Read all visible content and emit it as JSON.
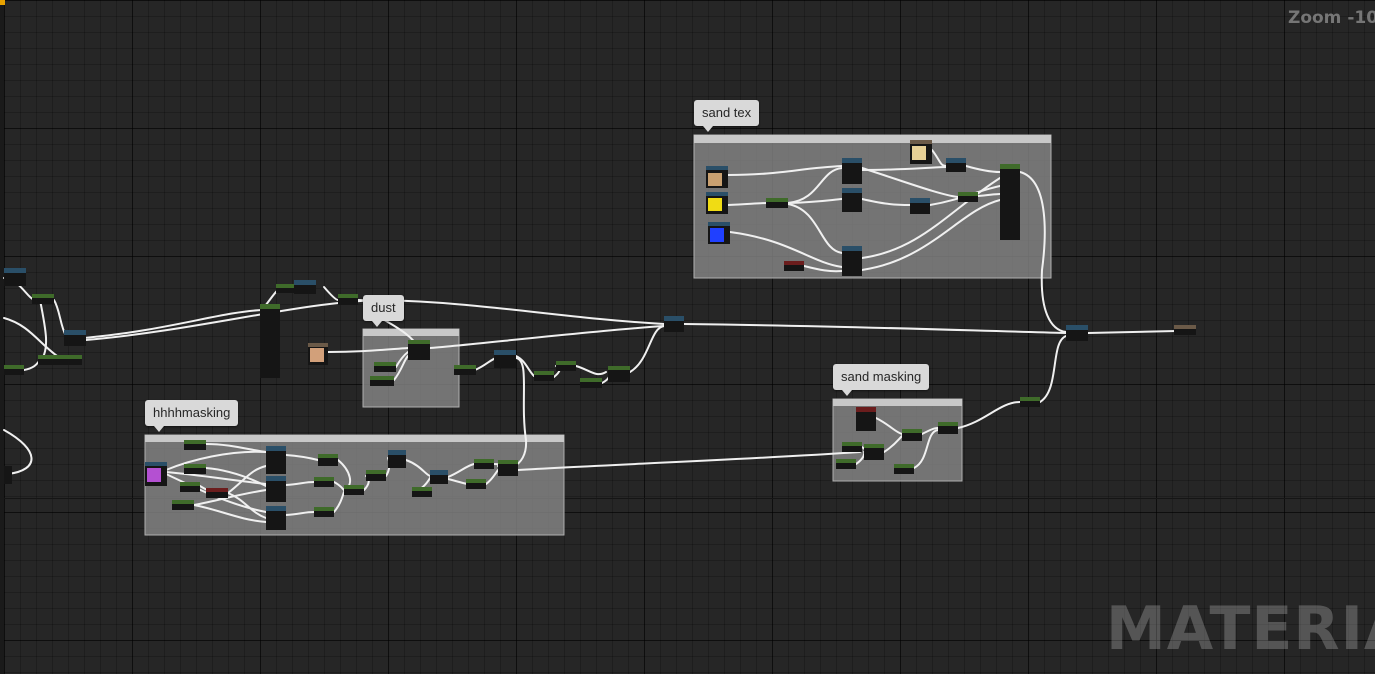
{
  "viewport": {
    "zoom_label": "Zoom -10",
    "watermark": "MATERIAL"
  },
  "colors": {
    "background": "#262626",
    "comment_box": "#8a8a8a",
    "comment_bubble": "#d9d9d9",
    "wire": "#f0f0f0",
    "node_body": "#151515",
    "header_constant": "#3f6b2a",
    "header_math": "#2a4f68",
    "header_parameter": "#6b1d1d",
    "header_result": "#6b5a48"
  },
  "comments": [
    {
      "id": "sand-tex",
      "label": "sand tex"
    },
    {
      "id": "dust",
      "label": "dust"
    },
    {
      "id": "hhhhmasking",
      "label": "hhhhmasking"
    },
    {
      "id": "sand-masking",
      "label": "sand masking"
    }
  ],
  "texture_thumbnails": [
    {
      "name": "sand-tan",
      "color": "#c9a070"
    },
    {
      "name": "sand-yellow",
      "color": "#f0dc14"
    },
    {
      "name": "sand-blue",
      "color": "#2040ff"
    },
    {
      "name": "sand-cream",
      "color": "#e6d096"
    },
    {
      "name": "dust-tan",
      "color": "#d2a07a"
    },
    {
      "name": "mask-magenta",
      "color": "#b450d2"
    }
  ]
}
